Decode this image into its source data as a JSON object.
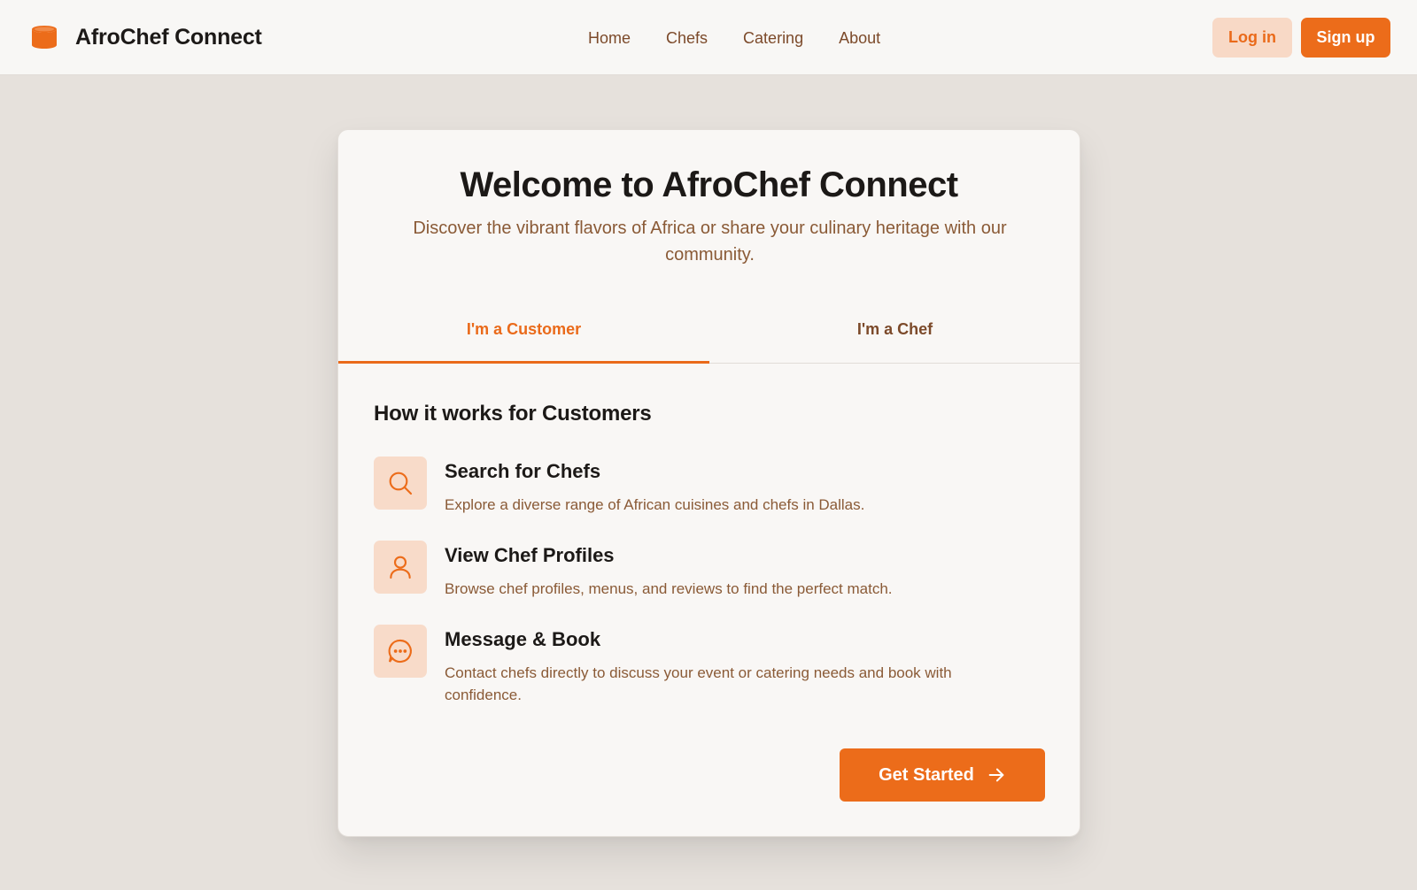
{
  "header": {
    "brand_name": "AfroChef Connect",
    "nav": [
      "Home",
      "Chefs",
      "Catering",
      "About"
    ],
    "login_label": "Log in",
    "signup_label": "Sign up"
  },
  "card": {
    "title": "Welcome to AfroChef Connect",
    "subtitle": "Discover the vibrant flavors of Africa or share your culinary heritage with our community.",
    "tabs": [
      {
        "label": "I'm a Customer",
        "active": true
      },
      {
        "label": "I'm a Chef",
        "active": false
      }
    ],
    "section_title": "How it works for Customers",
    "steps": [
      {
        "icon": "search-icon",
        "title": "Search for Chefs",
        "description": "Explore a diverse range of African cuisines and chefs in Dallas."
      },
      {
        "icon": "user-icon",
        "title": "View Chef Profiles",
        "description": "Browse chef profiles, menus, and reviews to find the perfect match."
      },
      {
        "icon": "message-icon",
        "title": "Message & Book",
        "description": "Contact chefs directly to discuss your event or catering needs and book with confidence."
      }
    ],
    "cta_label": "Get Started"
  },
  "colors": {
    "accent": "#ec6c1a",
    "accent_soft": "#f8dbc9",
    "text_brown": "#8a5a36",
    "background": "#f7f5f3"
  }
}
